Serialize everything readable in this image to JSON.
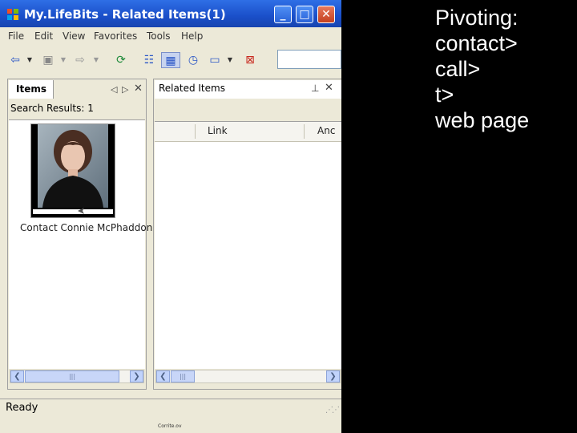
{
  "window": {
    "title": "My.LifeBits - Related Items(1)",
    "controls": {
      "minimize": "_",
      "maximize": "□",
      "close": "✕"
    }
  },
  "menu": [
    "File",
    "Edit",
    "View",
    "Favorites",
    "Tools",
    "Help"
  ],
  "toolbar_icons": {
    "back": "back-arrow-icon",
    "camera": "camera-icon",
    "forward": "forward-arrow-icon",
    "refresh": "refresh-icon",
    "view_details": "details-view-icon",
    "view_thumbnails": "thumbnails-view-icon",
    "timeline": "clock-icon",
    "window": "window-icon",
    "delete": "delete-icon"
  },
  "items_pane": {
    "tab_label": "Items",
    "search_results": "Search Results: 1",
    "item_caption": "Contact Connie McPhaddon"
  },
  "related_pane": {
    "tab_label": "Related Items",
    "columns": [
      "Link",
      "Anc"
    ]
  },
  "status": {
    "text": "Ready"
  },
  "footer_note": "Corrite.ov",
  "slide": {
    "lines": [
      "Pivoting:",
      "contact>",
      "call>",
      "t>",
      "web page"
    ]
  },
  "colors": {
    "title_bar": "#1a4fc9",
    "window_bg": "#ece9d8",
    "slide_bg": "#000000",
    "slide_text": "#ffffff"
  }
}
